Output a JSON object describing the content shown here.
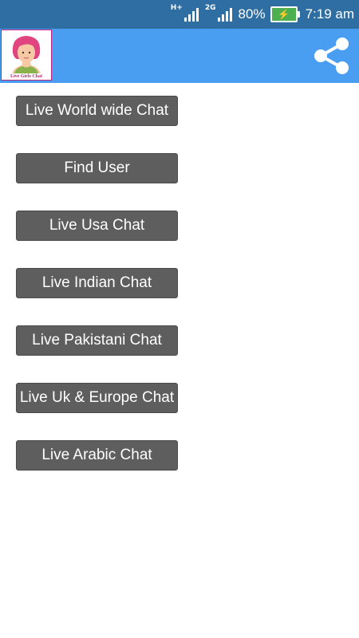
{
  "status_bar": {
    "network_type": "H+",
    "network_type_2": "2G",
    "battery_percent": "80%",
    "time": "7:19 am",
    "icons": [
      "signal-icon",
      "signal-icon",
      "battery-charging-icon"
    ]
  },
  "action_bar": {
    "logo_text": "Live Girls Chat",
    "icon": "share-icon",
    "color": "#4a9ef2"
  },
  "menu": {
    "buttons": [
      {
        "label": "Live World wide Chat"
      },
      {
        "label": "Find User"
      },
      {
        "label": "Live Usa Chat"
      },
      {
        "label": "Live Indian Chat"
      },
      {
        "label": "Live Pakistani Chat"
      },
      {
        "label": "Live Uk & Europe Chat"
      },
      {
        "label": "Live Arabic Chat"
      }
    ],
    "button_color": "#5e5e5e"
  }
}
